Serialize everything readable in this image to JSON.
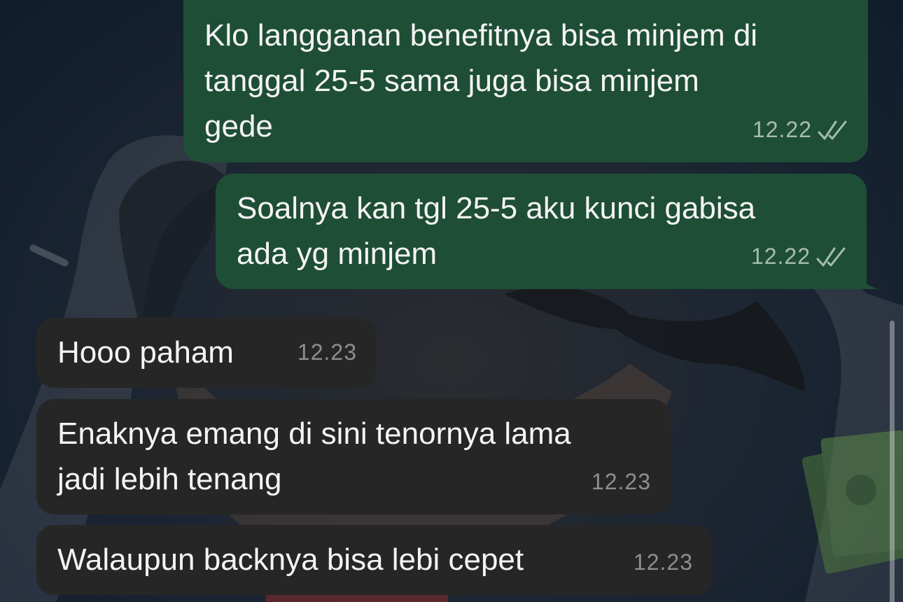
{
  "messages": [
    {
      "direction": "outgoing",
      "text": "Klo langganan benefitnya bisa minjem di\ntanggal 25-5 sama juga bisa minjem\ngede",
      "time": "12.22",
      "status_icon": "double-check-icon"
    },
    {
      "direction": "outgoing",
      "text": "Soalnya kan tgl 25-5 aku kunci gabisa\nada yg minjem",
      "time": "12.22",
      "status_icon": "double-check-icon"
    },
    {
      "direction": "incoming",
      "text": "Hooo paham",
      "time": "12.23"
    },
    {
      "direction": "incoming",
      "text": "Enaknya emang di sini tenornya lama\njadi lebih tenang",
      "time": "12.23"
    },
    {
      "direction": "incoming",
      "text": "Walaupun backnya bisa lebi cepet",
      "time": "12.23"
    }
  ],
  "colors": {
    "outgoing_bubble": "#1f4e36",
    "incoming_bubble": "#262626",
    "text": "#f4f4f4"
  }
}
